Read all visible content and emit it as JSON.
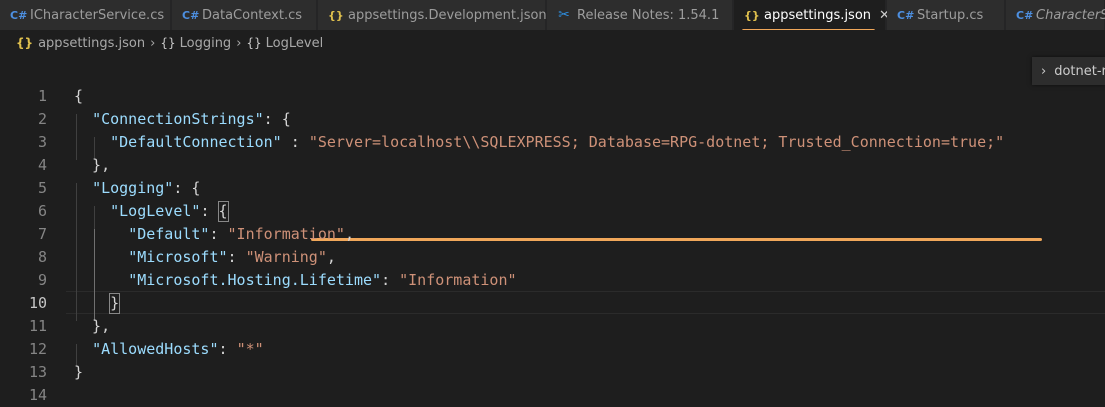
{
  "tabs": [
    {
      "icon": "csharp-icon",
      "label": "ICharacterService.cs",
      "active": false
    },
    {
      "icon": "csharp-icon",
      "label": "DataContext.cs",
      "active": false
    },
    {
      "icon": "json-icon",
      "label": "appsettings.Development.json",
      "active": false
    },
    {
      "icon": "vscode-icon",
      "label": "Release Notes: 1.54.1",
      "active": false
    },
    {
      "icon": "json-icon",
      "label": "appsettings.json",
      "active": true
    },
    {
      "icon": "csharp-icon",
      "label": "Startup.cs",
      "active": false
    },
    {
      "icon": "csharp-icon",
      "label": "CharacterSe",
      "active": false
    }
  ],
  "breadcrumb": [
    "appsettings.json",
    "Logging",
    "LogLevel"
  ],
  "outline": {
    "label": "dotnet-r"
  },
  "editor": {
    "active_line": 10,
    "line_numbers": [
      "1",
      "2",
      "3",
      "4",
      "5",
      "6",
      "7",
      "8",
      "9",
      "10",
      "11",
      "12",
      "13",
      "14"
    ],
    "lines": [
      [
        {
          "t": "punc",
          "v": "{"
        }
      ],
      [
        {
          "t": "punc",
          "v": "  "
        },
        {
          "t": "key",
          "v": "\"ConnectionStrings\""
        },
        {
          "t": "punc",
          "v": ": {"
        }
      ],
      [
        {
          "t": "punc",
          "v": "    "
        },
        {
          "t": "key",
          "v": "\"DefaultConnection\""
        },
        {
          "t": "punc",
          "v": " : "
        },
        {
          "t": "str",
          "v": "\"Server=localhost\\\\SQLEXPRESS; Database=RPG-dotnet; Trusted_Connection=true;\""
        }
      ],
      [
        {
          "t": "punc",
          "v": "  },"
        }
      ],
      [
        {
          "t": "punc",
          "v": "  "
        },
        {
          "t": "key",
          "v": "\"Logging\""
        },
        {
          "t": "punc",
          "v": ": {"
        }
      ],
      [
        {
          "t": "punc",
          "v": "    "
        },
        {
          "t": "key",
          "v": "\"LogLevel\""
        },
        {
          "t": "punc",
          "v": ": "
        },
        {
          "t": "box",
          "v": "{"
        }
      ],
      [
        {
          "t": "punc",
          "v": "      "
        },
        {
          "t": "key",
          "v": "\"Default\""
        },
        {
          "t": "punc",
          "v": ": "
        },
        {
          "t": "str",
          "v": "\"Information\""
        },
        {
          "t": "punc",
          "v": ","
        }
      ],
      [
        {
          "t": "punc",
          "v": "      "
        },
        {
          "t": "key",
          "v": "\"Microsoft\""
        },
        {
          "t": "punc",
          "v": ": "
        },
        {
          "t": "str",
          "v": "\"Warning\""
        },
        {
          "t": "punc",
          "v": ","
        }
      ],
      [
        {
          "t": "punc",
          "v": "      "
        },
        {
          "t": "key",
          "v": "\"Microsoft.Hosting.Lifetime\""
        },
        {
          "t": "punc",
          "v": ": "
        },
        {
          "t": "str",
          "v": "\"Information\""
        }
      ],
      [
        {
          "t": "punc",
          "v": "    "
        },
        {
          "t": "box",
          "v": "}"
        }
      ],
      [
        {
          "t": "punc",
          "v": "  },"
        }
      ],
      [
        {
          "t": "punc",
          "v": "  "
        },
        {
          "t": "key",
          "v": "\"AllowedHosts\""
        },
        {
          "t": "punc",
          "v": ": "
        },
        {
          "t": "str",
          "v": "\"*\""
        }
      ],
      [
        {
          "t": "punc",
          "v": "}"
        }
      ],
      []
    ]
  },
  "colors": {
    "accent_underline": "#f0a75a",
    "key": "#9cdcfe",
    "string": "#ce9178",
    "punctuation": "#d4d4d4"
  }
}
